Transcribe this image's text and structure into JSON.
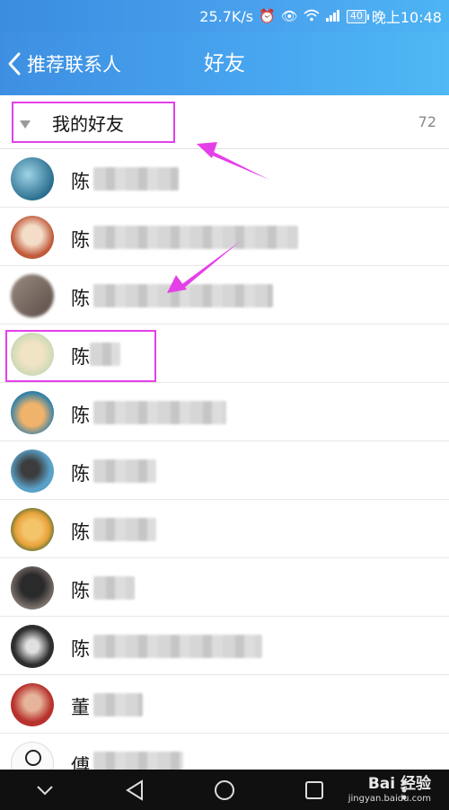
{
  "status_bar": {
    "speed": "25.7K/s",
    "battery": "40",
    "time": "晚上10:48"
  },
  "header": {
    "back_label": "推荐联系人",
    "title": "好友"
  },
  "group": {
    "title": "我的好友",
    "count": "72"
  },
  "friends": [
    {
      "name": "陈",
      "avatar_color": "#2b6f8f"
    },
    {
      "name": "陈",
      "avatar_color": "#c05a3a"
    },
    {
      "name": "陈",
      "avatar_color": "#7b6a63"
    },
    {
      "name": "陈",
      "avatar_color": "#cdd9b6"
    },
    {
      "name": "陈",
      "avatar_color": "#e79a3b"
    },
    {
      "name": "陈",
      "avatar_color": "#5aa1c8"
    },
    {
      "name": "陈",
      "avatar_color": "#e8a13a"
    },
    {
      "name": "陈",
      "avatar_color": "#3b3b3b"
    },
    {
      "name": "陈",
      "avatar_color": "#5a5a5a"
    },
    {
      "name": "董",
      "avatar_color": "#b8322d"
    },
    {
      "name": "傅",
      "avatar_color": "#f2f2f2"
    }
  ],
  "watermark": {
    "main": "Bai 经验",
    "sub": "jingyan.baidu.com"
  },
  "colors": {
    "accent": "#47a4ef",
    "highlight": "#e540e8"
  }
}
